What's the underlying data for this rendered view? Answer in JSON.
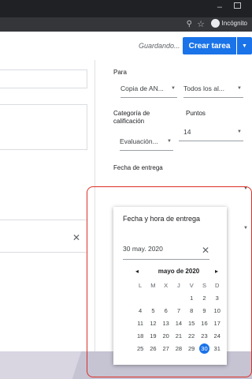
{
  "browser": {
    "mode_label": "Incógnito"
  },
  "toolbar": {
    "status": "Guardando...",
    "create_label": "Crear tarea"
  },
  "panel": {
    "para_label": "Para",
    "para_value": "Copia de AN...",
    "students_value": "Todos los al...",
    "grading_label": "Categoría de calificación",
    "grading_value": "Evaluación...",
    "points_label": "Puntos",
    "points_value": "14",
    "due_label": "Fecha de entrega"
  },
  "due_popup": {
    "title": "Fecha y hora de entrega",
    "date_value": "30 may. 2020"
  },
  "calendar": {
    "month": "mayo de 2020",
    "weekdays": [
      "L",
      "M",
      "X",
      "J",
      "V",
      "S",
      "D"
    ],
    "weeks": [
      [
        "",
        "",
        "",
        "",
        "1",
        "2",
        "3"
      ],
      [
        "4",
        "5",
        "6",
        "7",
        "8",
        "9",
        "10"
      ],
      [
        "11",
        "12",
        "13",
        "14",
        "15",
        "16",
        "17"
      ],
      [
        "18",
        "19",
        "20",
        "21",
        "22",
        "23",
        "24"
      ],
      [
        "25",
        "26",
        "27",
        "28",
        "29",
        "30",
        "31"
      ]
    ],
    "selected": "30"
  },
  "icons": {
    "close": "close-icon",
    "prev": "chevron-left-icon",
    "next": "chevron-right-icon"
  },
  "colors": {
    "accent": "#1a73e8",
    "highlight": "#d93025"
  }
}
